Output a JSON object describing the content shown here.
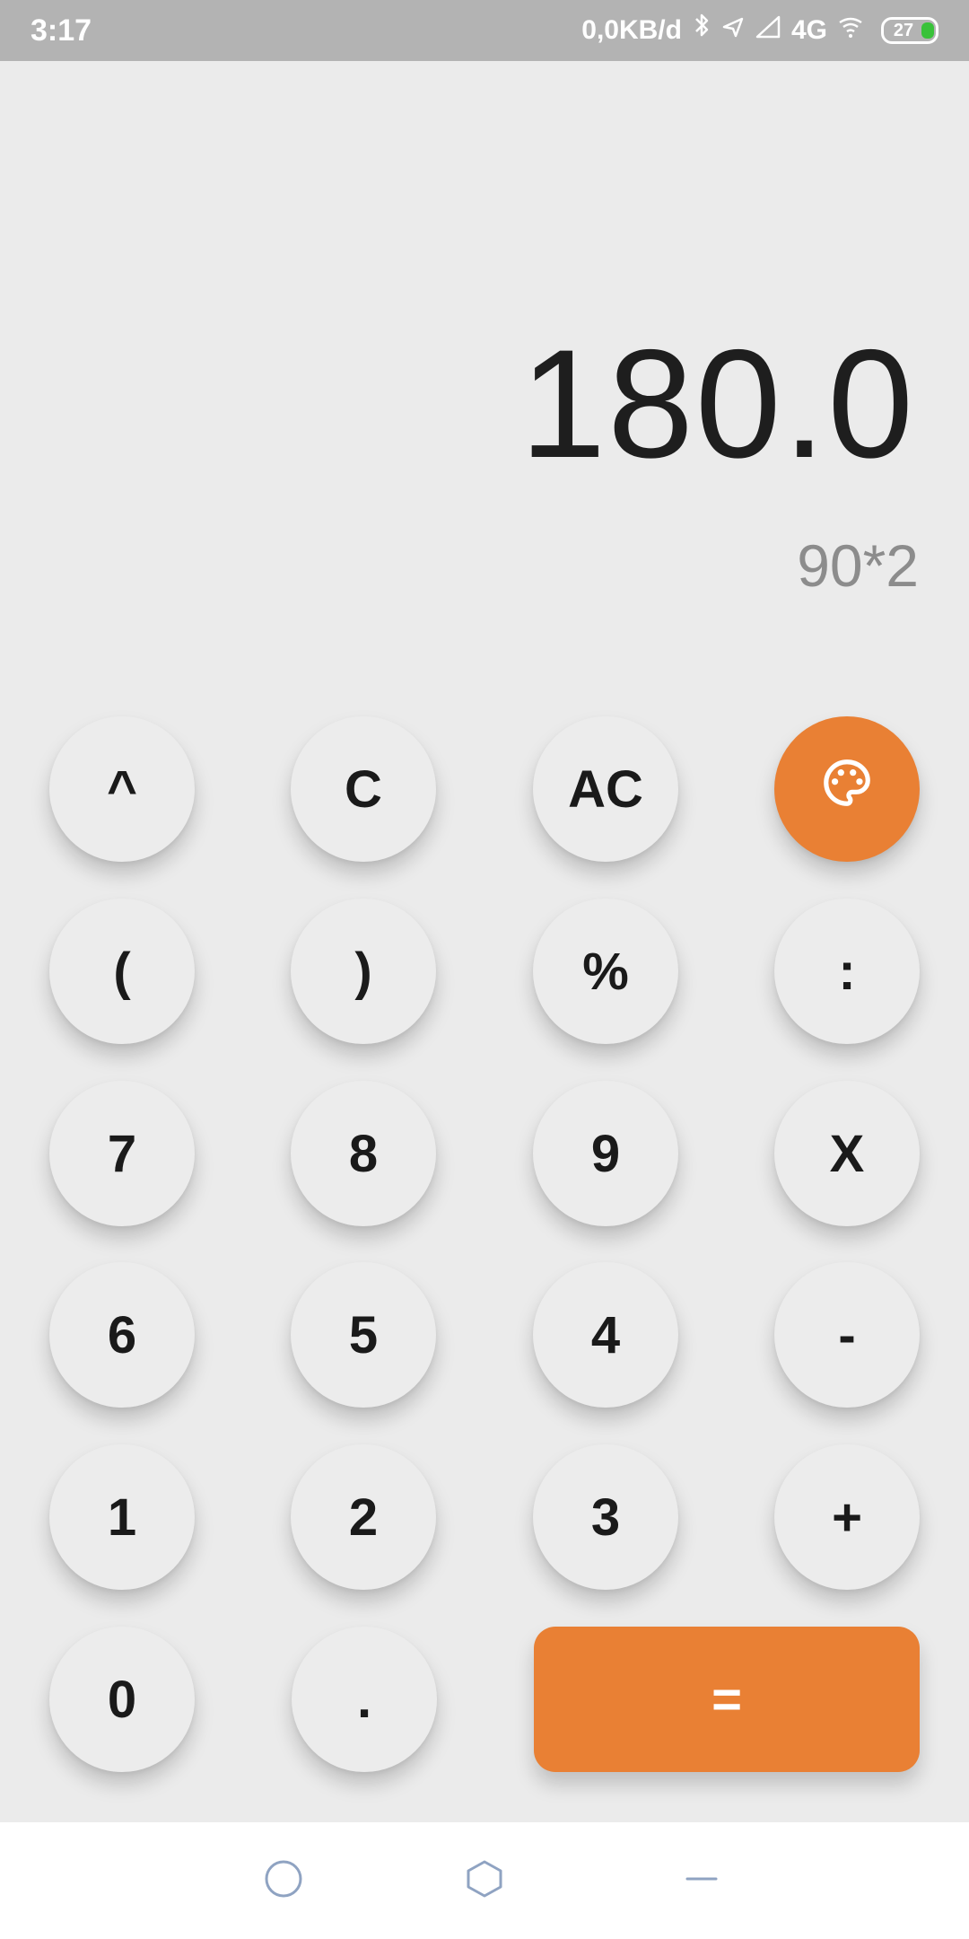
{
  "status_bar": {
    "time": "3:17",
    "network_speed": "0,0KB/d",
    "network_type": "4G",
    "battery_level": "27",
    "icons": [
      "bluetooth-icon",
      "location-icon",
      "signal-icon",
      "wifi-icon",
      "battery-icon"
    ]
  },
  "display": {
    "result": "180.0",
    "expression": "90*2"
  },
  "keypad": {
    "rows": [
      [
        "^",
        "C",
        "AC",
        "palette-icon"
      ],
      [
        "(",
        ")",
        "%",
        ":"
      ],
      [
        "7",
        "8",
        "9",
        "X"
      ],
      [
        "6",
        "5",
        "4",
        "-"
      ],
      [
        "1",
        "2",
        "3",
        "+"
      ],
      [
        "0",
        ".",
        "="
      ]
    ],
    "keys": {
      "caret": "^",
      "clear": "C",
      "all_clear": "AC",
      "open_paren": "(",
      "close_paren": ")",
      "percent": "%",
      "divide": ":",
      "seven": "7",
      "eight": "8",
      "nine": "9",
      "multiply": "X",
      "six": "6",
      "five": "5",
      "four": "4",
      "minus": "-",
      "one": "1",
      "two": "2",
      "three": "3",
      "plus": "+",
      "zero": "0",
      "dot": ".",
      "equals": "="
    }
  },
  "colors": {
    "accent": "#e98034",
    "background": "#ebebeb",
    "status_bar": "#b3b3b3",
    "result_text": "#1e1e1e",
    "expression_text": "#8c8c8c"
  },
  "nav_bar": {
    "buttons": [
      "recents-icon",
      "home-icon",
      "back-icon"
    ]
  }
}
